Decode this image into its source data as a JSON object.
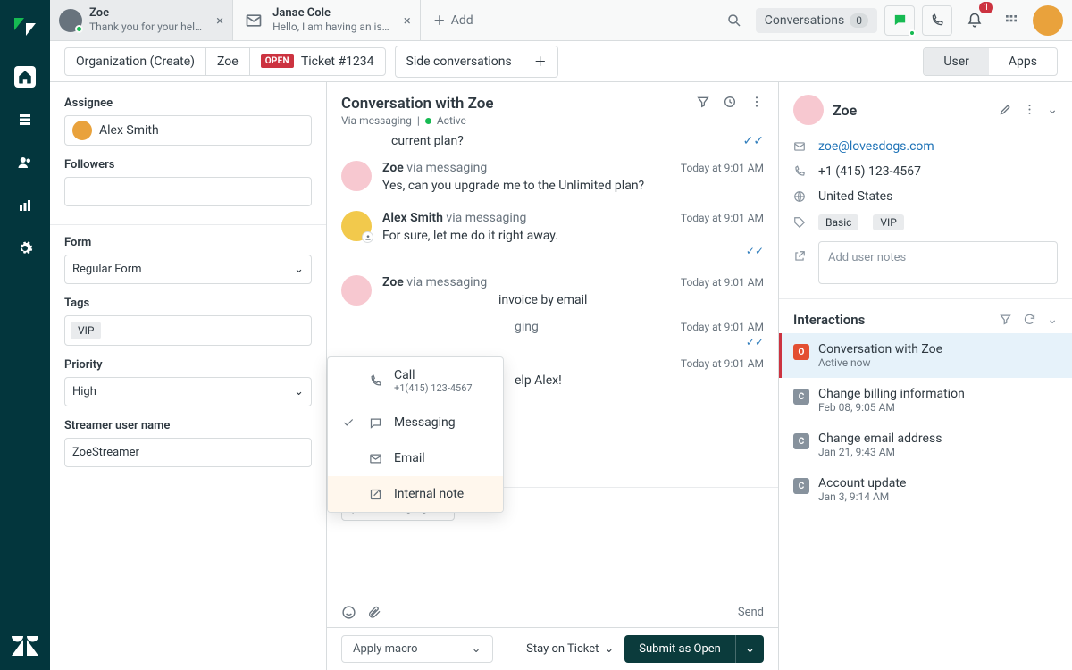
{
  "tabs": [
    {
      "title": "Zoe",
      "subtitle": "Thank you for your hel…",
      "type": "chat",
      "active": true
    },
    {
      "title": "Janae Cole",
      "subtitle": "Hello, I am having an is…",
      "type": "email",
      "active": false
    }
  ],
  "add_tab_label": "Add",
  "global": {
    "conversations_label": "Conversations",
    "conversations_count": "0",
    "notifications_count": "1"
  },
  "toolbar": {
    "org_label": "Organization (Create)",
    "requester": "Zoe",
    "status_badge": "OPEN",
    "ticket_label": "Ticket #1234",
    "side_conversations": "Side conversations",
    "tab_user": "User",
    "tab_apps": "Apps"
  },
  "left": {
    "assignee_label": "Assignee",
    "assignee_name": "Alex Smith",
    "followers_label": "Followers",
    "followers_value": "",
    "form_label": "Form",
    "form_value": "Regular Form",
    "tags_label": "Tags",
    "tags": [
      "VIP"
    ],
    "priority_label": "Priority",
    "priority_value": "High",
    "custom_label": "Streamer user name",
    "custom_value": "ZoeStreamer"
  },
  "conversation": {
    "title": "Conversation with Zoe",
    "via_label": "Via messaging",
    "status": "Active",
    "fragment_top": "current plan?",
    "messages": [
      {
        "who": "Zoe",
        "via": "via messaging",
        "time": "Today at 9:01 AM",
        "text": "Yes, can you upgrade me to the Unlimited plan?",
        "avatar": "zoe",
        "check": false
      },
      {
        "who": "Alex Smith",
        "via": "via messaging",
        "time": "Today at 9:01 AM",
        "text": "For sure, let me do it right away.",
        "avatar": "alex",
        "check": true
      },
      {
        "who": "Zoe",
        "via": "via messaging",
        "time": "Today at 9:01 AM",
        "text": "invoice by email",
        "avatar": "zoe",
        "check": false,
        "truncated_left": true
      },
      {
        "who": "",
        "via": "ging",
        "time": "Today at 9:01 AM",
        "text": "",
        "avatar": "",
        "check": true,
        "headeronly": true
      },
      {
        "who": "",
        "via": "",
        "time": "Today at 9:01 AM",
        "text": "elp Alex!",
        "avatar": "",
        "check": false,
        "textonly": true
      }
    ],
    "channel_selector": "Messaging",
    "send_label": "Send",
    "macro_label": "Apply macro",
    "stay_label": "Stay on Ticket",
    "submit_label": "Submit as Open"
  },
  "channel_menu": {
    "call_label": "Call",
    "call_sub": "+1(415) 123-4567",
    "messaging_label": "Messaging",
    "email_label": "Email",
    "internal_label": "Internal note"
  },
  "user": {
    "name": "Zoe",
    "email": "zoe@lovesdogs.com",
    "phone": "+1 (415) 123-4567",
    "location": "United States",
    "tags": [
      "Basic",
      "VIP"
    ],
    "notes_placeholder": "Add user notes"
  },
  "interactions": {
    "header": "Interactions",
    "items": [
      {
        "badge": "O",
        "title": "Conversation with Zoe",
        "sub": "Active now",
        "active": true
      },
      {
        "badge": "C",
        "title": "Change billing information",
        "sub": "Feb 08, 9:05 AM"
      },
      {
        "badge": "C",
        "title": "Change email address",
        "sub": "Jan 21, 9:43 AM"
      },
      {
        "badge": "C",
        "title": "Account update",
        "sub": "Jan 3, 9:14 AM"
      }
    ]
  }
}
